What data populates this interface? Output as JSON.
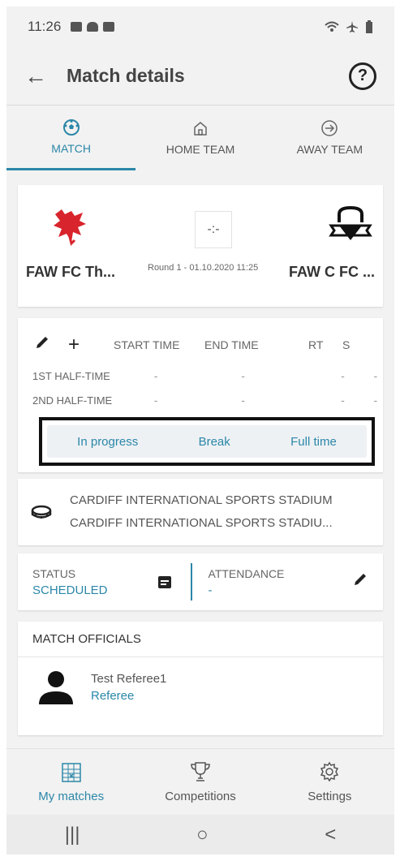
{
  "status_bar": {
    "time": "11:26"
  },
  "app_bar": {
    "title": "Match details",
    "help": "?"
  },
  "tabs": [
    {
      "label": "MATCH",
      "icon": "soccer-ball-icon"
    },
    {
      "label": "HOME TEAM",
      "icon": "home-icon"
    },
    {
      "label": "AWAY TEAM",
      "icon": "plane-icon"
    }
  ],
  "match": {
    "home_team": "FAW FC Th...",
    "away_team": "FAW C FC ...",
    "score": "-:-",
    "round": "Round 1 - 01.10.2020 11:25"
  },
  "times": {
    "headers": {
      "start": "START TIME",
      "end": "END TIME",
      "rt": "RT",
      "st": "S T"
    },
    "rows": [
      {
        "label": "1ST HALF-TIME",
        "start": "-",
        "end": "-",
        "rt": "-",
        "st": "-"
      },
      {
        "label": "2ND HALF-TIME",
        "start": "-",
        "end": "-",
        "rt": "-",
        "st": "-"
      }
    ],
    "buttons": {
      "in_progress": "In progress",
      "break": "Break",
      "full_time": "Full time"
    }
  },
  "stadium": {
    "line1": "CARDIFF INTERNATIONAL SPORTS STADIUM",
    "line2": "CARDIFF INTERNATIONAL SPORTS STADIU..."
  },
  "status": {
    "label": "STATUS",
    "value": "SCHEDULED"
  },
  "attendance": {
    "label": "ATTENDANCE",
    "value": "-"
  },
  "officials": {
    "title": "MATCH OFFICIALS",
    "items": [
      {
        "name": "Test Referee1",
        "role": "Referee"
      }
    ]
  },
  "bottom_nav": [
    {
      "label": "My matches",
      "icon": "calendar-grid-icon"
    },
    {
      "label": "Competitions",
      "icon": "trophy-icon"
    },
    {
      "label": "Settings",
      "icon": "gear-icon"
    }
  ],
  "system_nav": {
    "recents": "|||",
    "home": "○",
    "back": "<"
  },
  "colors": {
    "accent": "#2b87a8",
    "background": "#f2f2f2"
  }
}
